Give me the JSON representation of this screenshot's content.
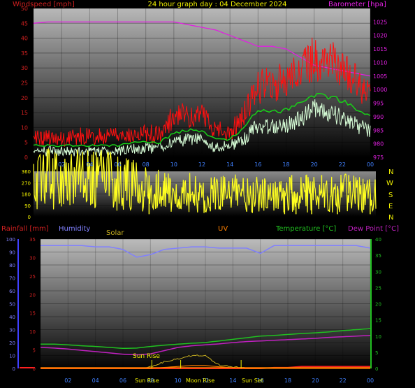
{
  "header": {
    "title": "24 hour graph day : 04 December 2024",
    "left_label": "Windspeed [mph]",
    "right_label": "Barometer [hpa]"
  },
  "colors": {
    "wind_gust": "#ff1010",
    "wind_avg": "#18d018",
    "wind_speed": "#d8ffd8",
    "barometer": "#e020e0",
    "direction": "#ffff20",
    "humidity": "#8080ff",
    "temperature": "#20c020",
    "dewpoint": "#c020c0",
    "rainfall": "#ff2020",
    "solar": "#c8b020",
    "uv": "#ff8000",
    "axis_text_wind": "#d02020",
    "axis_text_baro": "#e020e0"
  },
  "lower_header": {
    "rainfall": "Rainfall [mm]",
    "humidity": "Humidity",
    "solar": "Solar",
    "uv": "UV",
    "temperature": "Temperature [°C]",
    "dewpoint": "Dew Point [°C]"
  },
  "compass": [
    "N",
    "W",
    "S",
    "E",
    "N"
  ],
  "events": [
    "Sun Rise",
    "Sun Rise",
    "Moon Rise",
    "Sun Set"
  ],
  "chart_data": [
    {
      "type": "line",
      "title": "24 hour graph day : 04 December 2024",
      "ylabel": "Windspeed [mph]",
      "y2label": "Barometer [hpa]",
      "x_ticks": [
        "02",
        "04",
        "06",
        "08",
        "10",
        "12",
        "14",
        "16",
        "18",
        "20",
        "22",
        "00"
      ],
      "ylim": [
        0,
        50
      ],
      "y_ticks": [
        0,
        5,
        10,
        15,
        20,
        25,
        30,
        35,
        40,
        45,
        50
      ],
      "y2lim": [
        975,
        1030
      ],
      "y2_ticks": [
        975,
        980,
        985,
        990,
        995,
        1000,
        1005,
        1010,
        1015,
        1020,
        1025
      ],
      "x": [
        0,
        1,
        2,
        3,
        4,
        5,
        6,
        7,
        8,
        9,
        10,
        11,
        12,
        13,
        14,
        15,
        16,
        17,
        18,
        19,
        20,
        21,
        22,
        23,
        24
      ],
      "series": [
        {
          "key": "gust",
          "values": [
            7,
            7,
            6,
            7,
            7,
            7,
            7,
            8,
            8,
            8,
            14,
            14,
            14,
            9,
            8,
            15,
            24,
            24,
            26,
            30,
            33,
            32,
            30,
            25,
            20
          ]
        },
        {
          "key": "avg",
          "values": [
            4,
            4,
            4,
            4,
            4,
            4,
            4,
            5,
            5,
            5,
            8,
            9,
            9,
            6,
            6,
            10,
            16,
            15,
            16,
            18,
            21,
            20,
            19,
            16,
            14
          ]
        },
        {
          "key": "speed",
          "values": [
            2,
            2,
            2,
            2,
            2,
            2,
            2,
            3,
            3,
            3,
            5,
            6,
            6,
            3,
            4,
            6,
            11,
            10,
            11,
            13,
            16,
            15,
            14,
            11,
            9
          ]
        },
        {
          "key": "barometer",
          "values": [
            1024.5,
            1025,
            1025,
            1025,
            1025,
            1025,
            1025,
            1025,
            1025,
            1025,
            1025,
            1024,
            1023,
            1022,
            1020,
            1018,
            1016,
            1016,
            1015,
            1012,
            1009,
            1008,
            1007,
            1006,
            1005
          ]
        }
      ]
    },
    {
      "type": "line",
      "ylabel": "Wind direction",
      "ylim": [
        0,
        360
      ],
      "y_ticks": [
        0,
        90,
        180,
        270,
        360
      ],
      "x": [
        0,
        1,
        2,
        3,
        4,
        5,
        6,
        7,
        8,
        9,
        10,
        11,
        12,
        13,
        14,
        15,
        16,
        17,
        18,
        19,
        20,
        21,
        22,
        23,
        24
      ],
      "series": [
        {
          "key": "direction",
          "values": [
            285,
            300,
            300,
            295,
            285,
            290,
            270,
            250,
            220,
            200,
            195,
            190,
            180,
            180,
            190,
            180,
            180,
            175,
            180,
            185,
            185,
            190,
            190,
            185,
            180
          ]
        }
      ]
    },
    {
      "type": "line",
      "x_ticks": [
        "02",
        "04",
        "06",
        "08",
        "10",
        "12",
        "14",
        "16",
        "18",
        "20",
        "22",
        "00"
      ],
      "humidity_lim": [
        0,
        100
      ],
      "humidity_ticks": [
        0,
        10,
        20,
        30,
        40,
        50,
        60,
        70,
        80,
        90,
        100
      ],
      "rain_lim": [
        0,
        35
      ],
      "rain_ticks": [
        0,
        5,
        10,
        15,
        20,
        25,
        30,
        35
      ],
      "temp_lim": [
        0,
        40
      ],
      "temp_ticks": [
        0,
        5,
        10,
        15,
        20,
        25,
        30,
        35,
        40
      ],
      "x": [
        0,
        1,
        2,
        3,
        4,
        5,
        6,
        7,
        8,
        9,
        10,
        11,
        12,
        13,
        14,
        15,
        16,
        17,
        18,
        19,
        20,
        21,
        22,
        23,
        24
      ],
      "series": [
        {
          "key": "humidity",
          "values": [
            95,
            95,
            95,
            95,
            94,
            94,
            92,
            86,
            88,
            92,
            93,
            94,
            94,
            93,
            93,
            93,
            89,
            95,
            95,
            95,
            95,
            95,
            95,
            95,
            93
          ]
        },
        {
          "key": "temperature",
          "values": [
            7.5,
            7.5,
            7.3,
            7,
            6.8,
            6.5,
            6.2,
            6.3,
            6.8,
            7.2,
            7.5,
            7.8,
            8,
            8.5,
            9,
            9.5,
            10,
            10.2,
            10.5,
            10.8,
            11,
            11.3,
            11.7,
            12,
            12.3
          ]
        },
        {
          "key": "dewpoint",
          "values": [
            6.5,
            6.3,
            6,
            5.6,
            5.2,
            4.8,
            4.4,
            4.2,
            4.5,
            5.5,
            6.5,
            7,
            7.3,
            7.6,
            8,
            8.3,
            8.5,
            8.7,
            8.9,
            9.1,
            9.3,
            9.6,
            9.8,
            10,
            10.2
          ]
        },
        {
          "key": "rainfall",
          "values": [
            0,
            0,
            0,
            0,
            0,
            0,
            0,
            0,
            0,
            0,
            0,
            0,
            0,
            0,
            0,
            0,
            0,
            0.2,
            0.2,
            0.5,
            0.5,
            0.5,
            0.5,
            0.5,
            0.5
          ]
        },
        {
          "key": "solar",
          "values": [
            0,
            0,
            0,
            0,
            0,
            0,
            0,
            0,
            0.5,
            2,
            3,
            4,
            4,
            1,
            0.5,
            0,
            0,
            0,
            0,
            0,
            0,
            0,
            0,
            0,
            0
          ]
        },
        {
          "key": "uv",
          "values": [
            0,
            0,
            0,
            0,
            0,
            0,
            0,
            0,
            0,
            0.3,
            0.6,
            0.9,
            0.9,
            0.5,
            0.2,
            0,
            0,
            0,
            0,
            0,
            0,
            0,
            0,
            0,
            0
          ]
        }
      ]
    }
  ]
}
